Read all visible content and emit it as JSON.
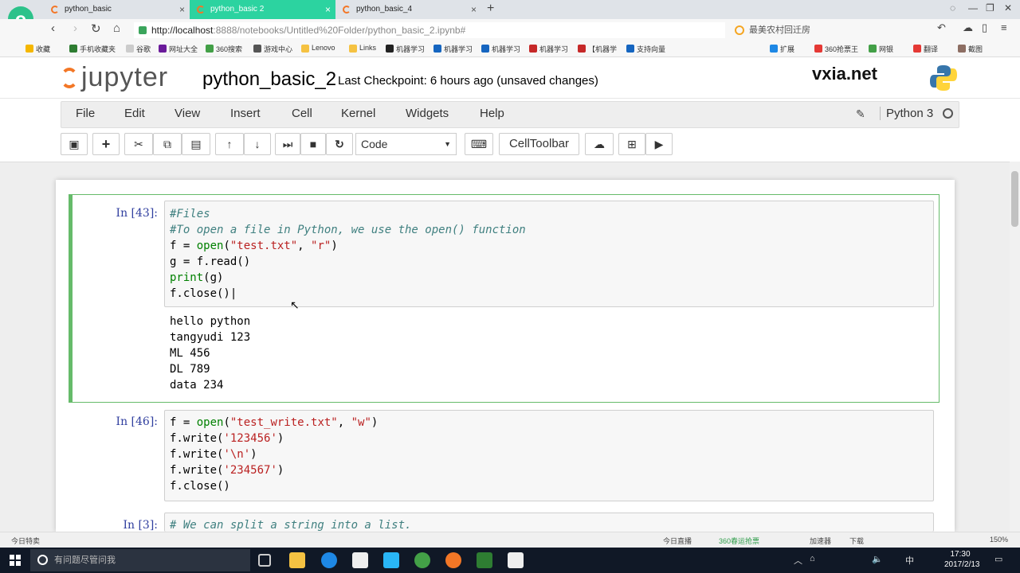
{
  "browser": {
    "tabs": [
      {
        "label": "python_basic",
        "close": "×"
      },
      {
        "label": "python_basic 2",
        "close": "×"
      },
      {
        "label": "python_basic_4",
        "close": "×"
      }
    ],
    "new_tab": "+",
    "url_host": "http://localhost",
    "url_rest": ":8888/notebooks/Untitled%20Folder/python_basic_2.ipynb#",
    "search_text": "最美农村回迁房",
    "bookmarks": [
      "收藏",
      "手机收藏夹",
      "谷歌",
      "网址大全",
      "360搜索",
      "游戏中心",
      "Lenovo",
      "Links",
      "机器学习",
      "机器学习",
      "机器学习",
      "机器学习",
      "【机器学",
      "支持向量",
      "扩展",
      "360抢票王",
      "网银",
      "翻译",
      "截图"
    ]
  },
  "jupyter": {
    "logo": "jupyter",
    "notebook_name": "python_basic_2",
    "checkpoint": "Last Checkpoint: 6 hours ago (unsaved changes)",
    "brand": "vxia.net",
    "menu": [
      "File",
      "Edit",
      "View",
      "Insert",
      "Cell",
      "Kernel",
      "Widgets",
      "Help"
    ],
    "kernel_name": "Python 3",
    "cell_type": "Code",
    "celltoolbar_label": "CellToolbar"
  },
  "cells": [
    {
      "prompt": "In [43]:",
      "output": "hello python\ntangyudi 123\nML 456\nDL 789\ndata 234"
    },
    {
      "prompt": "In [46]:"
    },
    {
      "prompt": "In [3]:"
    }
  ],
  "status": {
    "left": "今日特卖",
    "live": "今日直播",
    "ticket": "360春运抢票",
    "accel": "加速器",
    "download": "下载",
    "zoom": "150%"
  },
  "taskbar": {
    "search_placeholder": "有问题尽管问我",
    "time": "17:30",
    "date": "2017/2/13",
    "ime": "中"
  }
}
